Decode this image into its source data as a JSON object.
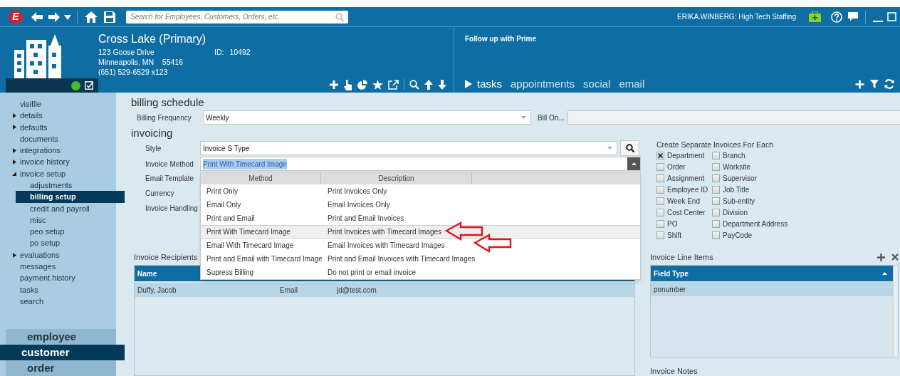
{
  "toolbar": {
    "logo_letter": "E",
    "search_placeholder": "Search for Employees, Customers, Orders, etc.",
    "user_label": "ERIKA.WINBERG: High Tech Staffing"
  },
  "record": {
    "name": "Cross Lake (Primary)",
    "address_line": "123 Goose Drive",
    "city_line": "Minneapolis, MN    55416",
    "phone": "(651) 529-6529 x123",
    "id_label": "ID:",
    "id_value": "10492"
  },
  "followup": {
    "note": "Follow up with Prime"
  },
  "activity_tabs": [
    {
      "label": "tasks",
      "selected": true
    },
    {
      "label": "appointments",
      "selected": false
    },
    {
      "label": "social",
      "selected": false
    },
    {
      "label": "email",
      "selected": false
    }
  ],
  "sidebar": {
    "items": [
      {
        "label": "visifile",
        "kind": "leaf",
        "selected": false
      },
      {
        "label": "details",
        "kind": "branch",
        "expanded": false,
        "selected": false
      },
      {
        "label": "defaults",
        "kind": "branch",
        "expanded": false,
        "selected": false
      },
      {
        "label": "documents",
        "kind": "leaf",
        "selected": false
      },
      {
        "label": "integrations",
        "kind": "branch",
        "expanded": false,
        "selected": false
      },
      {
        "label": "invoice history",
        "kind": "branch",
        "expanded": false,
        "selected": false
      },
      {
        "label": "invoice setup",
        "kind": "branch",
        "expanded": true,
        "selected": false,
        "children": [
          {
            "label": "adjustments",
            "selected": false
          },
          {
            "label": "billing setup",
            "selected": true
          },
          {
            "label": "credit and payroll",
            "selected": false
          },
          {
            "label": "misc",
            "selected": false
          },
          {
            "label": "peo setup",
            "selected": false
          },
          {
            "label": "po setup",
            "selected": false
          }
        ]
      },
      {
        "label": "evaluations",
        "kind": "branch",
        "expanded": false,
        "selected": false
      },
      {
        "label": "messages",
        "kind": "leaf",
        "selected": false
      },
      {
        "label": "payment history",
        "kind": "leaf",
        "selected": false
      },
      {
        "label": "tasks",
        "kind": "leaf",
        "selected": false
      },
      {
        "label": "search",
        "kind": "leaf",
        "selected": false
      }
    ],
    "modules": [
      {
        "label": "employee",
        "selected": false
      },
      {
        "label": "customer",
        "selected": true
      },
      {
        "label": "order",
        "selected": false
      }
    ]
  },
  "billing_schedule": {
    "heading": "billing schedule",
    "frequency_label": "Billing Frequency",
    "frequency_value": "Weekly",
    "bill_on_label": "Bill On..."
  },
  "invoicing": {
    "heading": "invoicing",
    "fields": [
      {
        "label": "Style",
        "kind": "lookup",
        "value": "Invoice S Type"
      },
      {
        "label": "Invoice Method",
        "kind": "combo",
        "value": "Print With Timecard Image"
      },
      {
        "label": "Email Template",
        "kind": "hidden"
      },
      {
        "label": "Currency",
        "kind": "hidden"
      },
      {
        "label": "Invoice Handling",
        "kind": "hidden"
      }
    ]
  },
  "method_dropdown": {
    "columns": [
      "Method",
      "Description"
    ],
    "options": [
      {
        "method": "Print Only",
        "description": "Print Invoices Only",
        "selected": false
      },
      {
        "method": "Email Only",
        "description": "Email Invoices Only",
        "selected": false
      },
      {
        "method": "Print and Email",
        "description": "Print and Email Invoices",
        "selected": false
      },
      {
        "method": "Print With Timecard Image",
        "description": "Print Invoices with Timecard Images",
        "selected": true
      },
      {
        "method": "Email With Timecard Image",
        "description": "Email Invoices with Timecard Images",
        "selected": false
      },
      {
        "method": "Print and Email with Timecard Image",
        "description": "Print and Email Invoices with Timecard Images",
        "selected": false
      },
      {
        "method": "Supress Billing",
        "description": "Do not print or email invoice",
        "selected": false
      }
    ]
  },
  "separate_invoices": {
    "heading": "Create Separate Invoices For Each",
    "options": [
      {
        "label": "Department",
        "checked": true
      },
      {
        "label": "Branch",
        "checked": false
      },
      {
        "label": "Order",
        "checked": false
      },
      {
        "label": "Worksite",
        "checked": false
      },
      {
        "label": "Assignment",
        "checked": false
      },
      {
        "label": "Supervisor",
        "checked": false
      },
      {
        "label": "Employee ID",
        "checked": false
      },
      {
        "label": "Job Title",
        "checked": false
      },
      {
        "label": "Week End",
        "checked": false
      },
      {
        "label": "Sub-entity",
        "checked": false
      },
      {
        "label": "Cost Center",
        "checked": false
      },
      {
        "label": "Division",
        "checked": false
      },
      {
        "label": "PO",
        "checked": false
      },
      {
        "label": "Department Address",
        "checked": false
      },
      {
        "label": "Shift",
        "checked": false
      },
      {
        "label": "PayCode",
        "checked": false
      }
    ]
  },
  "recipients": {
    "heading": "Invoice Recipients",
    "columns": [
      "Name"
    ],
    "rows": [
      {
        "cells": [
          "Duffy, Jacob",
          "Email",
          "jd@test.com"
        ],
        "selected": true
      }
    ]
  },
  "line_items": {
    "heading": "Invoice Line Items",
    "columns": [
      "Field Type"
    ],
    "rows": [
      {
        "cells": [
          "ponumber"
        ],
        "selected": true
      }
    ]
  },
  "notes": {
    "heading": "Invoice Notes"
  }
}
